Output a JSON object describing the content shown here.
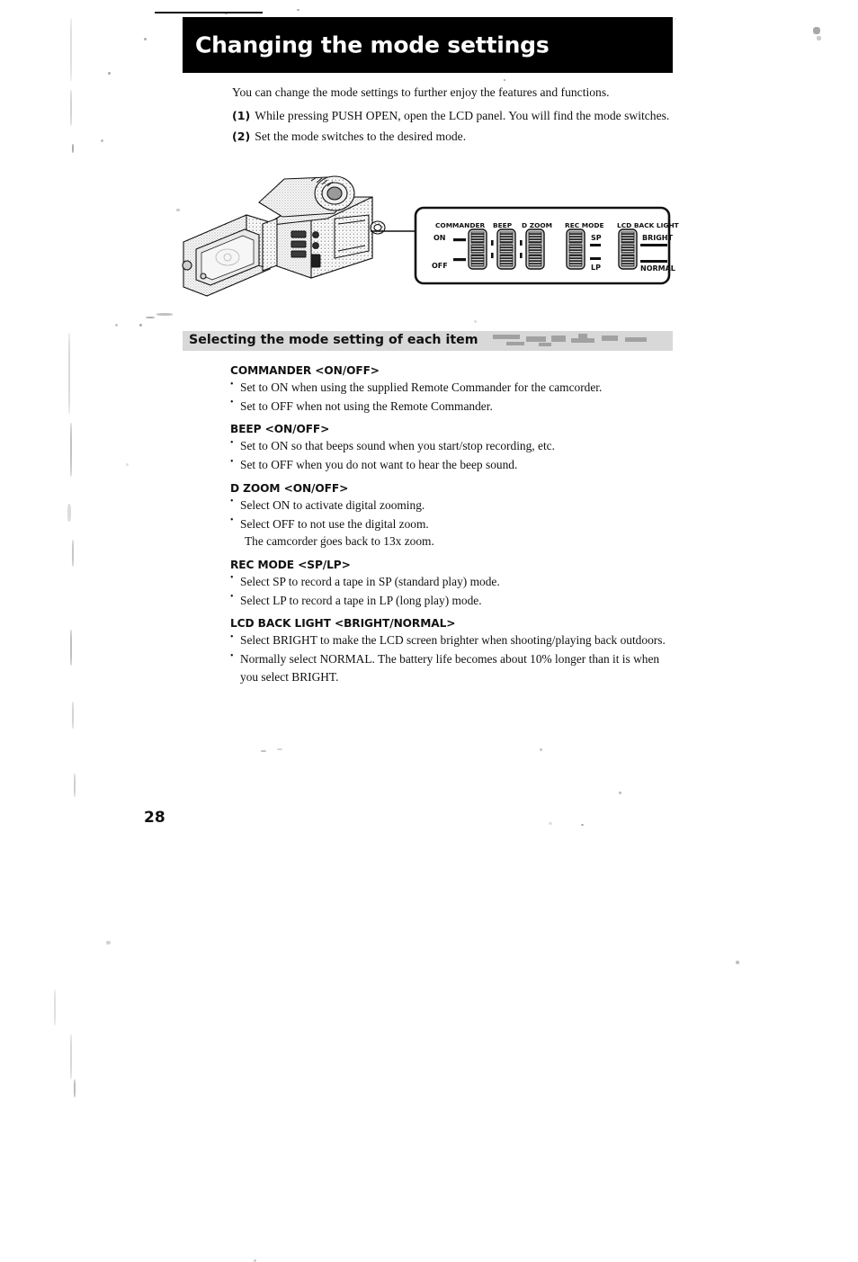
{
  "page": {
    "number": "28",
    "title": "Changing the mode settings"
  },
  "intro": {
    "lead": "You can change the mode settings to further enjoy the features and functions.",
    "steps": [
      {
        "num": "(1)",
        "text": "While pressing PUSH OPEN, open the LCD panel. You will find the mode switches."
      },
      {
        "num": "(2)",
        "text": "Set the mode switches to the desired mode."
      }
    ]
  },
  "figure": {
    "caption_alt": "camcorder-with-lcd-panel-open",
    "switch_panel": {
      "labels": [
        "COMMANDER",
        "BEEP",
        "D ZOOM",
        "REC MODE",
        "LCD BACK LIGHT"
      ],
      "commander_top": "ON",
      "commander_bottom": "OFF",
      "rec_mode_top": "SP",
      "rec_mode_bottom": "LP",
      "backlight_top": "BRIGHT",
      "backlight_bottom": "NORMAL"
    }
  },
  "section": {
    "heading": "Selecting the mode setting of each item"
  },
  "items": [
    {
      "heading": "COMMANDER <ON/OFF>",
      "bullets": [
        {
          "text": "Set to ON when using the supplied Remote Commander for the camcorder."
        },
        {
          "text": "Set to OFF when not using the Remote Commander."
        }
      ]
    },
    {
      "heading": "BEEP <ON/OFF>",
      "bullets": [
        {
          "text": "Set to ON so that beeps sound when you start/stop recording, etc."
        },
        {
          "text": "Set to OFF when you do not want to hear the beep sound."
        }
      ]
    },
    {
      "heading": "D ZOOM <ON/OFF>",
      "bullets": [
        {
          "text": "Select ON to activate digital zooming."
        },
        {
          "text": "Select OFF to not use the digital zoom.",
          "cont": "The camcorder goes back to 13x zoom."
        }
      ]
    },
    {
      "heading": "REC MODE <SP/LP>",
      "bullets": [
        {
          "text": "Select SP to record a tape in SP (standard play) mode."
        },
        {
          "text": "Select LP to record a tape in LP (long play) mode."
        }
      ]
    },
    {
      "heading": "LCD BACK LIGHT <BRIGHT/NORMAL>",
      "bullets": [
        {
          "text": "Select BRIGHT to make the LCD screen brighter when shooting/playing back outdoors."
        },
        {
          "text": "Normally select NORMAL. The battery life becomes about 10% longer than it is when you select BRIGHT."
        }
      ]
    }
  ],
  "colors": {
    "header_bg": "#000000",
    "header_text": "#ffffff",
    "band_bg": "#d8d8d8",
    "ink": "#111111",
    "paper": "#ffffff"
  }
}
